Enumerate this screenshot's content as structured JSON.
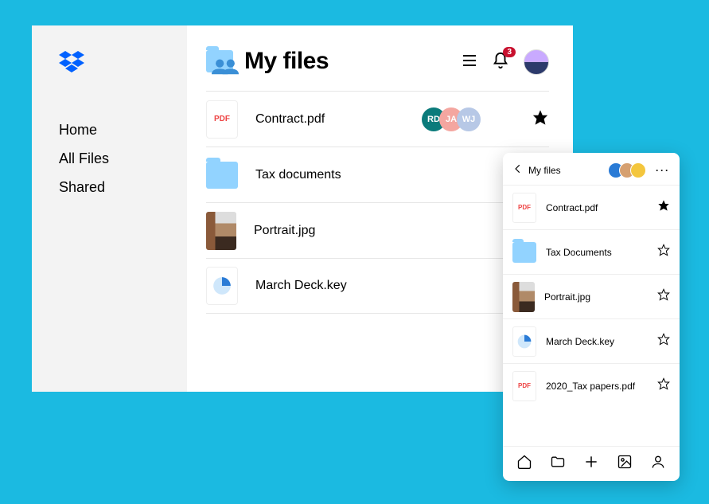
{
  "sidebar": {
    "items": [
      {
        "label": "Home"
      },
      {
        "label": "All Files"
      },
      {
        "label": "Shared"
      }
    ]
  },
  "header": {
    "title": "My files",
    "notif_count": "3"
  },
  "files": [
    {
      "name": "Contract.pdf",
      "type": "pdf",
      "collab": [
        "RD",
        "JA",
        "WJ"
      ],
      "starred": true
    },
    {
      "name": "Tax documents",
      "type": "folder",
      "starred": false
    },
    {
      "name": "Portrait.jpg",
      "type": "image",
      "starred": false
    },
    {
      "name": "March Deck.key",
      "type": "key",
      "starred": false
    }
  ],
  "mobile": {
    "title": "My files",
    "files": [
      {
        "name": "Contract.pdf",
        "type": "pdf",
        "starred": true
      },
      {
        "name": "Tax Documents",
        "type": "folder",
        "starred": false
      },
      {
        "name": "Portrait.jpg",
        "type": "image",
        "starred": false
      },
      {
        "name": "March Deck.key",
        "type": "key",
        "starred": false
      },
      {
        "name": "2020_Tax papers.pdf",
        "type": "pdf",
        "starred": false
      }
    ]
  },
  "icons": {
    "pdf_label": "PDF"
  }
}
